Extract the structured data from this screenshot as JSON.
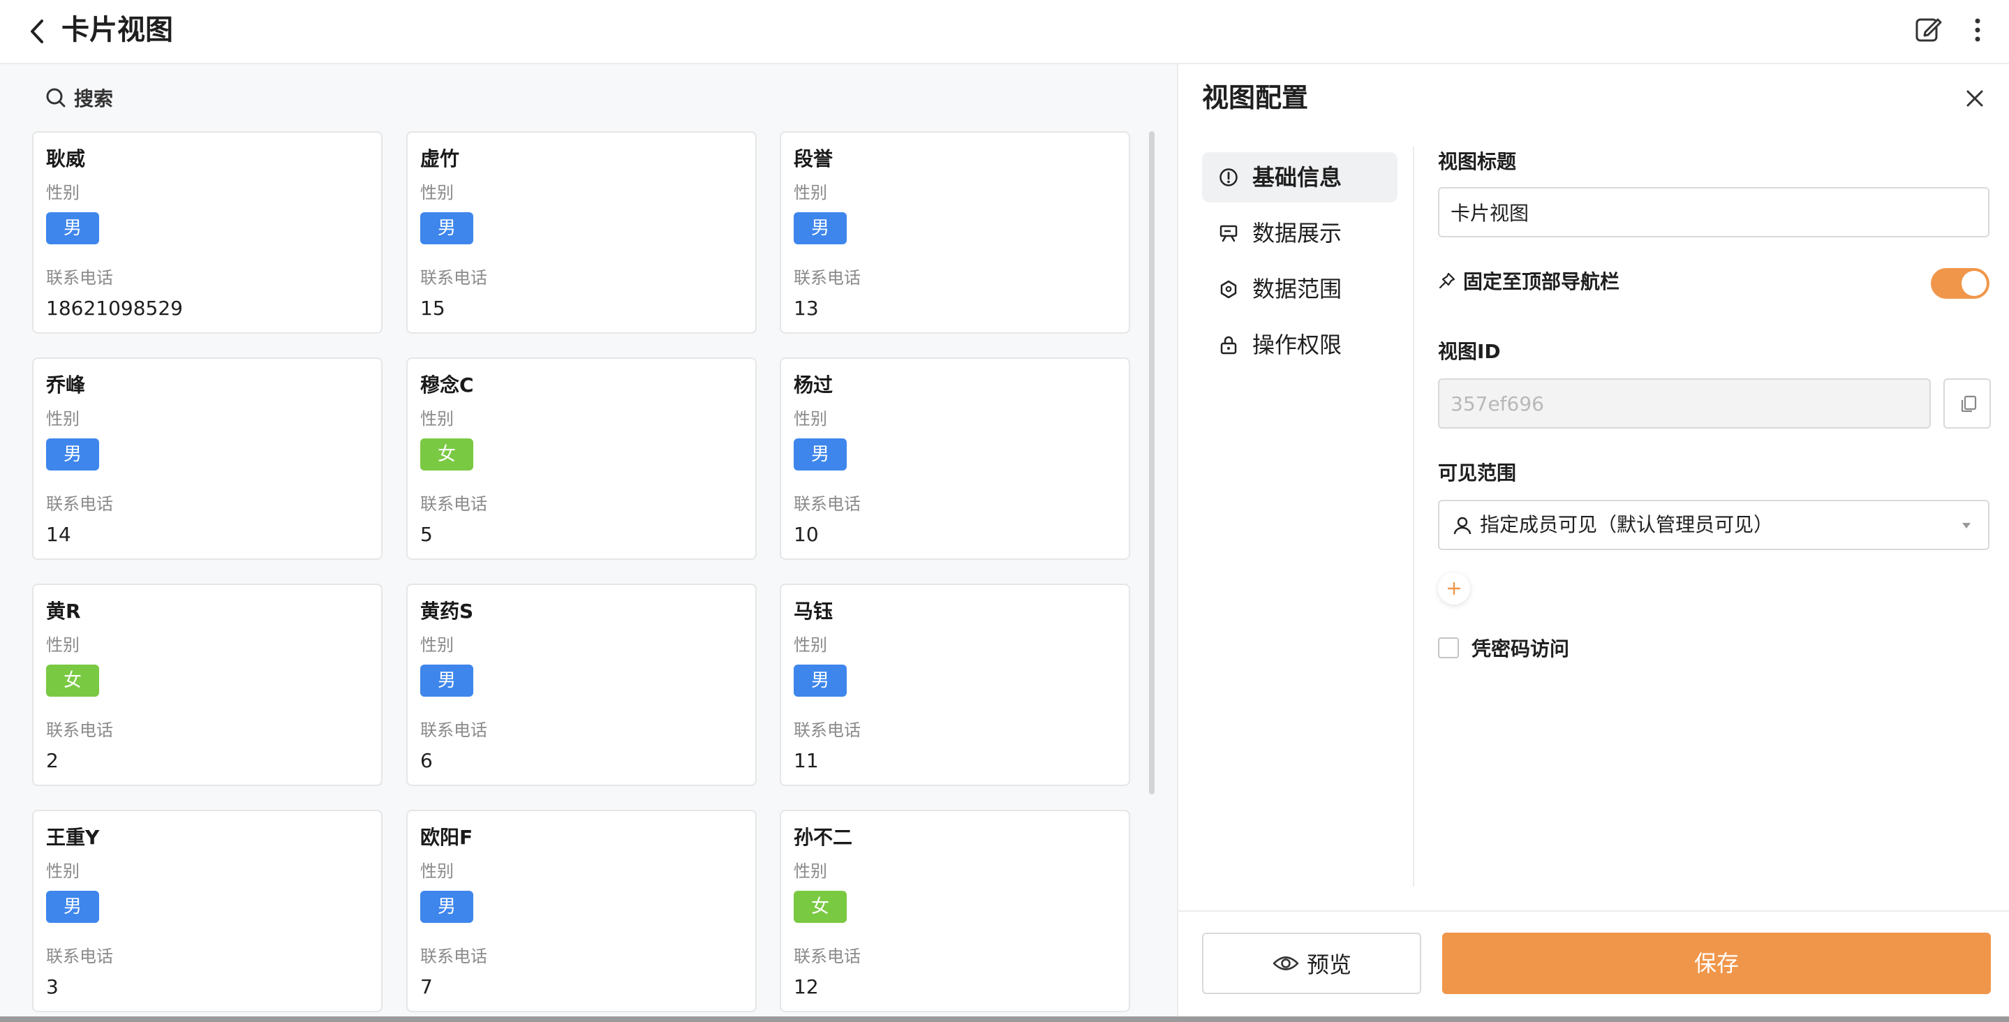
{
  "header": {
    "title": "卡片视图",
    "back_icon": "chevron-left-icon",
    "edit_icon": "edit-icon",
    "more_icon": "more-vertical-icon"
  },
  "search": {
    "label": "搜索",
    "icon": "search-icon"
  },
  "cards": [
    {
      "name": "耿威",
      "gender_label": "性别",
      "gender": "男",
      "phone_label": "联系电话",
      "phone": "18621098529"
    },
    {
      "name": "虚竹",
      "gender_label": "性别",
      "gender": "男",
      "phone_label": "联系电话",
      "phone": "15"
    },
    {
      "name": "段誉",
      "gender_label": "性别",
      "gender": "男",
      "phone_label": "联系电话",
      "phone": "13"
    },
    {
      "name": "乔峰",
      "gender_label": "性别",
      "gender": "男",
      "phone_label": "联系电话",
      "phone": "14"
    },
    {
      "name": "穆念C",
      "gender_label": "性别",
      "gender": "女",
      "phone_label": "联系电话",
      "phone": "5"
    },
    {
      "name": "杨过",
      "gender_label": "性别",
      "gender": "男",
      "phone_label": "联系电话",
      "phone": "10"
    },
    {
      "name": "黄R",
      "gender_label": "性别",
      "gender": "女",
      "phone_label": "联系电话",
      "phone": "2"
    },
    {
      "name": "黄药S",
      "gender_label": "性别",
      "gender": "男",
      "phone_label": "联系电话",
      "phone": "6"
    },
    {
      "name": "马钰",
      "gender_label": "性别",
      "gender": "男",
      "phone_label": "联系电话",
      "phone": "11"
    },
    {
      "name": "王重Y",
      "gender_label": "性别",
      "gender": "男",
      "phone_label": "联系电话",
      "phone": "3"
    },
    {
      "name": "欧阳F",
      "gender_label": "性别",
      "gender": "男",
      "phone_label": "联系电话",
      "phone": "7"
    },
    {
      "name": "孙不二",
      "gender_label": "性别",
      "gender": "女",
      "phone_label": "联系电话",
      "phone": "12"
    }
  ],
  "colors": {
    "male_tag": "#3e86ec",
    "female_tag": "#7ac943",
    "accent": "#f0964a"
  },
  "panel": {
    "title": "视图配置",
    "close_icon": "close-icon",
    "nav": [
      {
        "label": "基础信息",
        "icon": "info-icon",
        "active": true
      },
      {
        "label": "数据展示",
        "icon": "presentation-icon",
        "active": false
      },
      {
        "label": "数据范围",
        "icon": "range-icon",
        "active": false
      },
      {
        "label": "操作权限",
        "icon": "lock-icon",
        "active": false
      }
    ],
    "view_title_label": "视图标题",
    "view_title_value": "卡片视图",
    "pin_label": "固定至顶部导航栏",
    "pin_enabled": true,
    "view_id_label": "视图ID",
    "view_id_value": "357ef696",
    "visibility_label": "可见范围",
    "visibility_value": "指定成员可见（默认管理员可见）",
    "password_label": "凭密码访问",
    "password_checked": false,
    "preview_label": "预览",
    "save_label": "保存"
  }
}
